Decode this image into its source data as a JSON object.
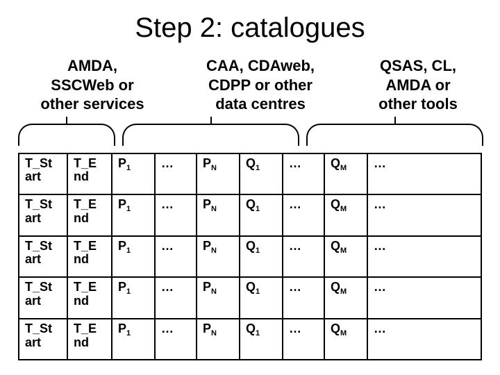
{
  "title": "Step 2: catalogues",
  "headers": {
    "h1": "AMDA,\nSSCWeb or\nother services",
    "h2": "CAA, CDAweb,\nCDPP or other\ndata centres",
    "h3": "QSAS, CL,\nAMDA or\nother tools"
  },
  "cells": {
    "c0": "T_St\nart",
    "c1": "T_E\nnd",
    "p1": "P",
    "p1_sub": "1",
    "dots": "…",
    "pn": "P",
    "pn_sub": "N",
    "q1": "Q",
    "q1_sub": "1",
    "qm": "Q",
    "qm_sub": "M"
  },
  "chart_data": {
    "type": "table",
    "title": "Step 2: catalogues",
    "column_groups": [
      {
        "label": "AMDA, SSCWeb or other services",
        "columns": [
          "T_Start",
          "T_End"
        ]
      },
      {
        "label": "CAA, CDAweb, CDPP or other data centres",
        "columns": [
          "P1",
          "…",
          "PN"
        ]
      },
      {
        "label": "QSAS, CL, AMDA or other tools",
        "columns": [
          "Q1",
          "…",
          "QM",
          "…"
        ]
      }
    ],
    "columns": [
      "T_Start",
      "T_End",
      "P1",
      "…",
      "PN",
      "Q1",
      "…",
      "QM",
      "…"
    ],
    "rows": [
      [
        "T_Start",
        "T_End",
        "P1",
        "…",
        "PN",
        "Q1",
        "…",
        "QM",
        "…"
      ],
      [
        "T_Start",
        "T_End",
        "P1",
        "…",
        "PN",
        "Q1",
        "…",
        "QM",
        "…"
      ],
      [
        "T_Start",
        "T_End",
        "P1",
        "…",
        "PN",
        "Q1",
        "…",
        "QM",
        "…"
      ],
      [
        "T_Start",
        "T_End",
        "P1",
        "…",
        "PN",
        "Q1",
        "…",
        "QM",
        "…"
      ],
      [
        "T_Start",
        "T_End",
        "P1",
        "…",
        "PN",
        "Q1",
        "…",
        "QM",
        "…"
      ]
    ],
    "row_count": 5
  }
}
